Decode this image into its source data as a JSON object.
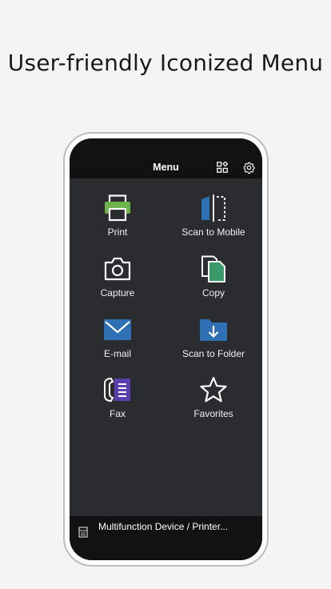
{
  "headline": "User-friendly Iconized Menu",
  "header": {
    "title": "Menu"
  },
  "menu": {
    "items": [
      {
        "label": "Print",
        "icon": "printer-icon"
      },
      {
        "label": "Scan to Mobile",
        "icon": "scan-to-mobile-icon"
      },
      {
        "label": "Capture",
        "icon": "camera-icon"
      },
      {
        "label": "Copy",
        "icon": "copy-icon"
      },
      {
        "label": "E-mail",
        "icon": "envelope-icon"
      },
      {
        "label": "Scan to Folder",
        "icon": "folder-download-icon"
      },
      {
        "label": "Fax",
        "icon": "fax-icon"
      },
      {
        "label": "Favorites",
        "icon": "star-icon"
      }
    ]
  },
  "footer": {
    "device_label": "Multifunction Device / Printer..."
  },
  "colors": {
    "background": "#f4f4f4",
    "screen": "#2b2c30",
    "bar": "#121212",
    "green": "#6bb34a",
    "blue": "#2f6fb3",
    "teal": "#3a9a6a",
    "purple": "#5a3fb0"
  }
}
